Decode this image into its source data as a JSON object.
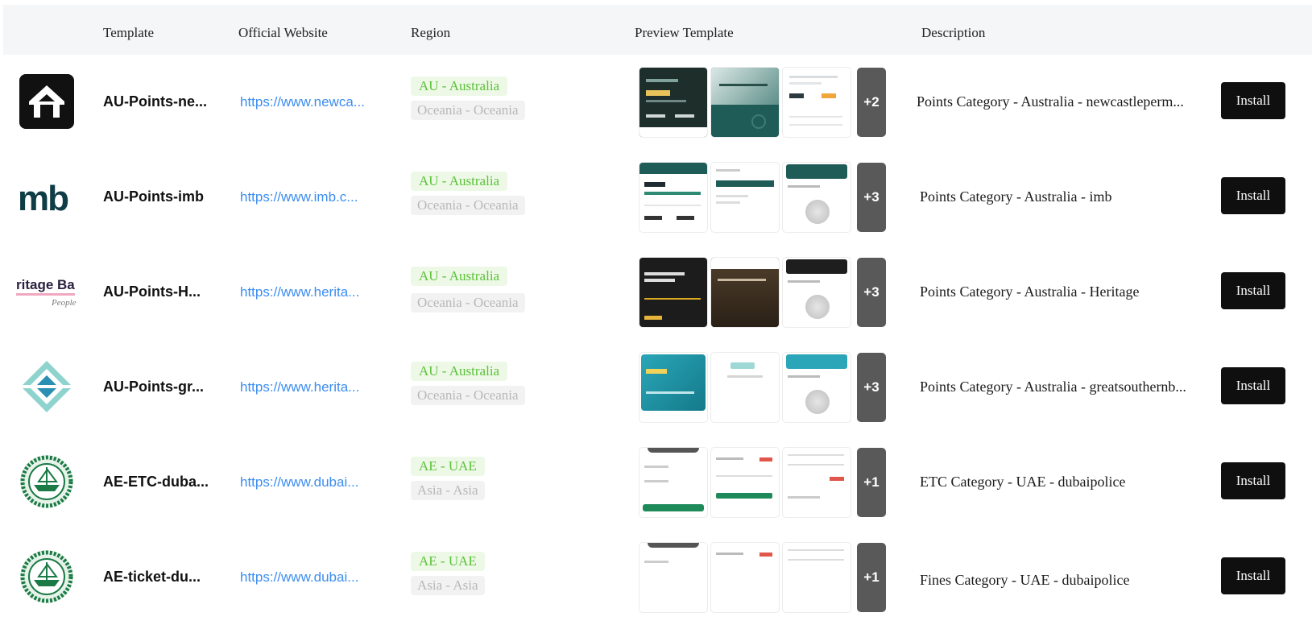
{
  "header": {
    "template": "Template",
    "website": "Official Website",
    "region": "Region",
    "preview": "Preview Template",
    "description": "Description"
  },
  "rows": [
    {
      "name": "AU-Points-ne...",
      "url": "https://www.newca...",
      "region_primary": "AU - Australia",
      "region_secondary": "Oceania - Oceania",
      "more": "+2",
      "description": "Points Category - Australia - newcastleperm...",
      "install": "Install",
      "logo": "house-logo-icon"
    },
    {
      "name": "AU-Points-imb",
      "url": "https://www.imb.c...",
      "region_primary": "AU - Australia",
      "region_secondary": "Oceania - Oceania",
      "more": "+3",
      "description": "Points Category - Australia - imb",
      "install": "Install",
      "logo": "imb-logo-icon",
      "logo_text": "mb"
    },
    {
      "name": "AU-Points-H...",
      "url": "https://www.herita...",
      "region_primary": "AU - Australia",
      "region_secondary": "Oceania - Oceania",
      "more": "+3",
      "description": "Points Category - Australia - Heritage",
      "install": "Install",
      "logo": "heritage-logo-icon",
      "logo_text": "ritage Ba",
      "logo_subtext": "People"
    },
    {
      "name": "AU-Points-gr...",
      "url": "https://www.herita...",
      "region_primary": "AU - Australia",
      "region_secondary": "Oceania - Oceania",
      "more": "+3",
      "description": "Points Category - Australia - greatsouthernb...",
      "install": "Install",
      "logo": "diamond-logo-icon"
    },
    {
      "name": "AE-ETC-duba...",
      "url": "https://www.dubai...",
      "region_primary": "AE - UAE",
      "region_secondary": "Asia - Asia",
      "more": "+1",
      "description": "ETC Category - UAE - dubaipolice",
      "install": "Install",
      "logo": "dubai-police-logo-icon"
    },
    {
      "name": "AE-ticket-du...",
      "url": "https://www.dubai...",
      "region_primary": "AE - UAE",
      "region_secondary": "Asia - Asia",
      "more": "+1",
      "description": "Fines Category - UAE - dubaipolice",
      "install": "Install",
      "logo": "dubai-police-logo-icon"
    }
  ],
  "colors": {
    "link": "#3c8df0",
    "tag_green_text": "#5cc23a",
    "tag_green_bg": "#edf9e6",
    "button_bg": "#0f0f0f",
    "more_bg": "#595959",
    "teal": "#1f5c58"
  }
}
